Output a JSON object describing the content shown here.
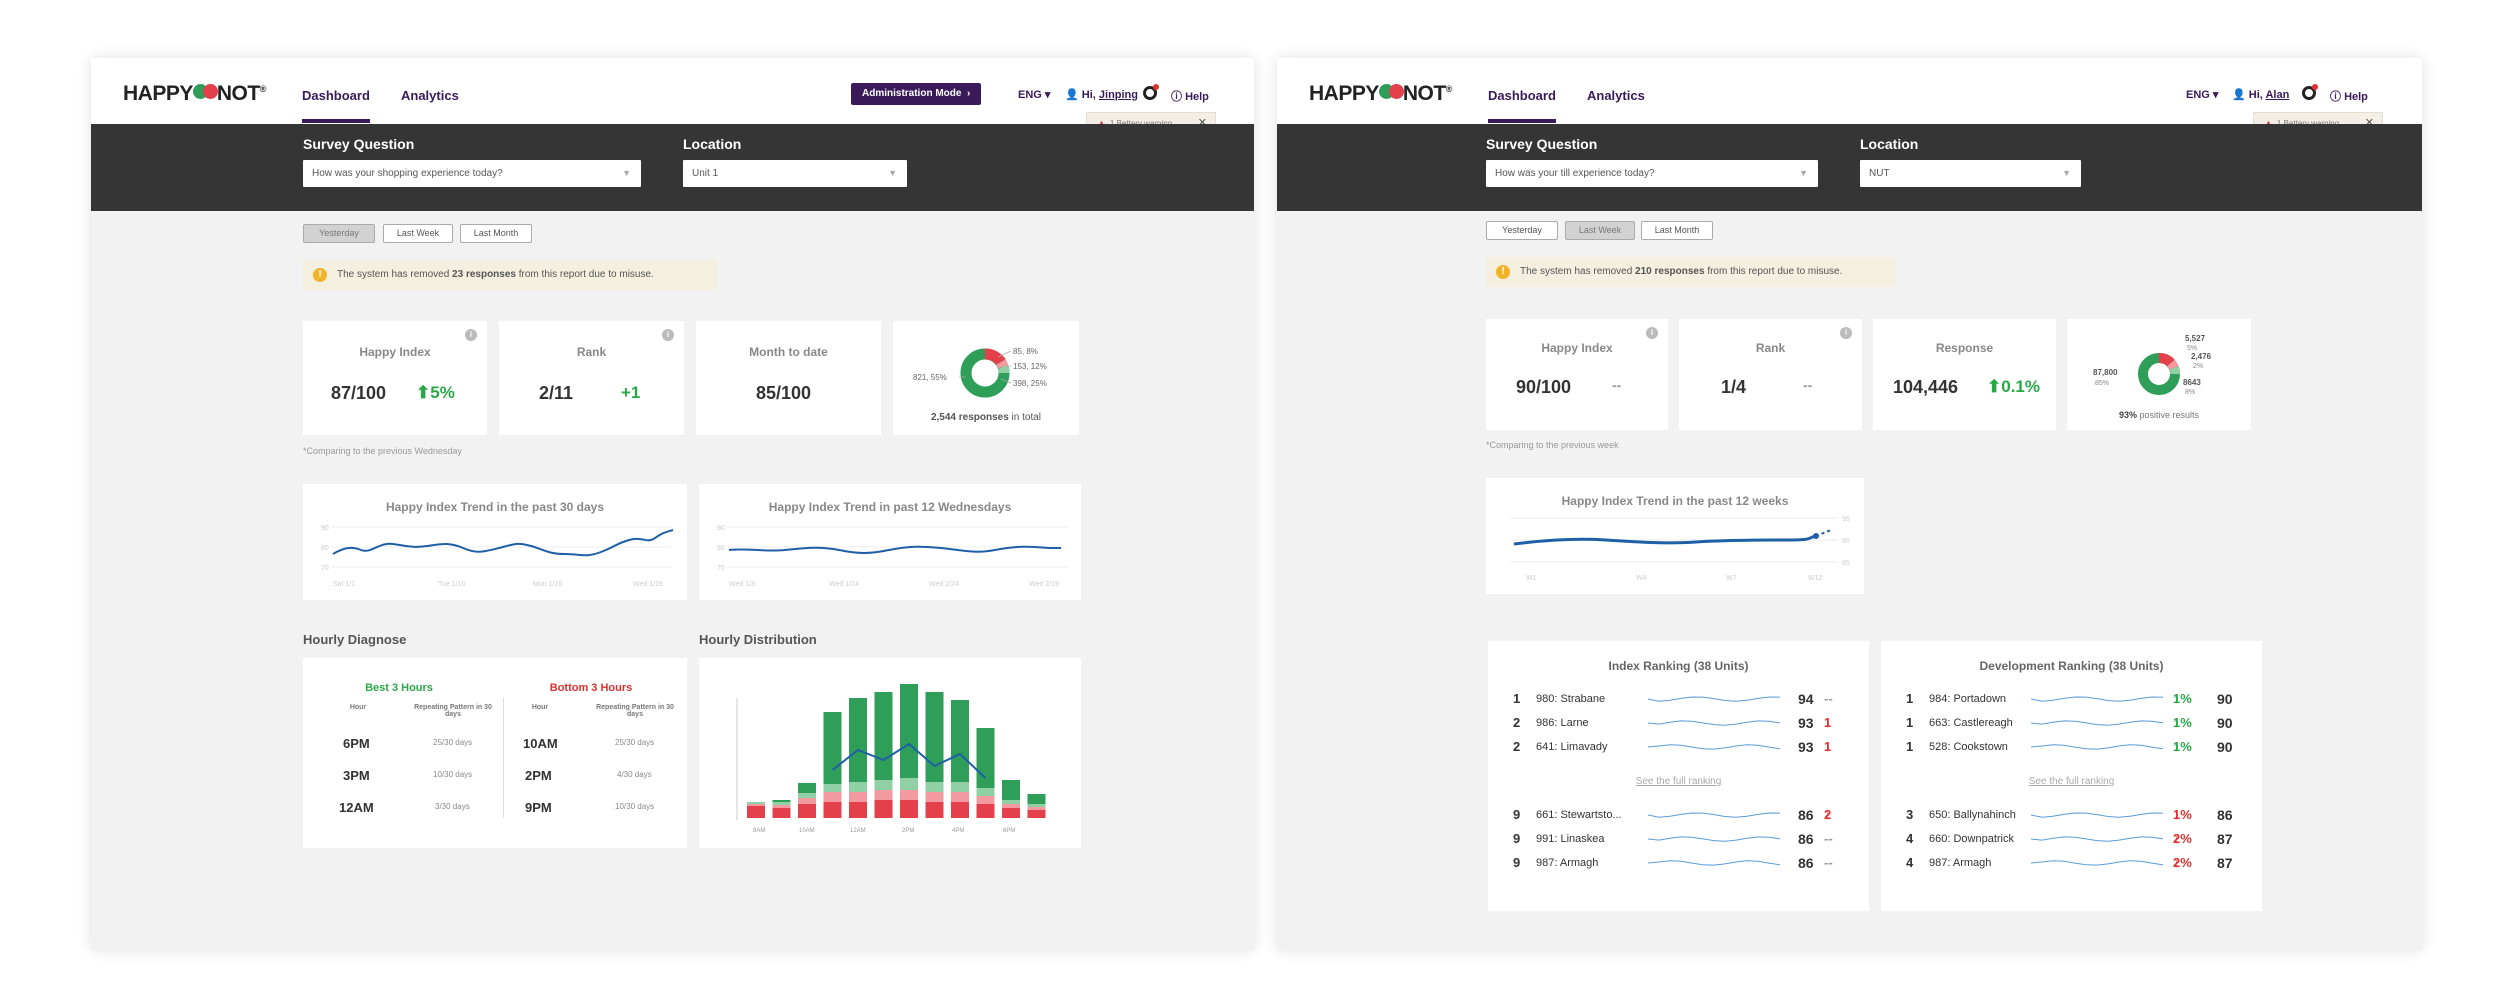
{
  "left": {
    "logo": "HAPPY NOT",
    "nav": {
      "dashboard": "Dashboard",
      "analytics": "Analytics"
    },
    "admin_button": "Administration Mode",
    "lang": "ENG",
    "greeting": "Hi,",
    "user": "Jinping",
    "help": "Help",
    "toast": "1 Bettery warning",
    "survey_label": "Survey Question",
    "survey_value": "How was your shopping experience today?",
    "location_label": "Location",
    "location_value": "Unit 1",
    "periods": [
      "Yesterday",
      "Last Week",
      "Last Month"
    ],
    "selected_period": "Yesterday",
    "notice_prefix": "The system has removed ",
    "notice_bold": "23 responses",
    "notice_suffix": " from this report due to misuse.",
    "kpi": {
      "happy_index": {
        "title": "Happy Index",
        "value": "87/100",
        "change": "5%"
      },
      "rank": {
        "title": "Rank",
        "value": "2/11",
        "change": "+1"
      },
      "mtd": {
        "title": "Month to date",
        "value": "85/100"
      },
      "donut": {
        "labels": [
          "85, 8%",
          "153, 12%",
          "398, 25%",
          "821, 55%"
        ],
        "total_bold": "2,544 responses",
        "total_suffix": " in total"
      }
    },
    "compare_note": "*Comparing to the previous Wednesday",
    "trend30": {
      "title": "Happy Index Trend in the past 30 days",
      "yticks": [
        "90",
        "80",
        "70"
      ],
      "xticks": [
        "Sat 1/1",
        "Tue 1/10",
        "Mon 1/16",
        "Wed 1/19"
      ]
    },
    "trend12": {
      "title": "Happy Index Trend in past 12 Wednesdays",
      "yticks": [
        "90",
        "80",
        "70"
      ],
      "xticks": [
        "Wed 1/3",
        "Wed 1/24",
        "Wed 2/24",
        "Wed 2/19"
      ]
    },
    "hourly_diagnose": {
      "title": "Hourly Diagnose",
      "best_title": "Best 3 Hours",
      "worst_title": "Bottom 3 Hours",
      "col_hour": "Hour",
      "col_pattern": "Repeating Pattern in 30 days",
      "best": [
        {
          "hour": "6PM",
          "pattern": "25/30 days"
        },
        {
          "hour": "3PM",
          "pattern": "10/30 days"
        },
        {
          "hour": "12AM",
          "pattern": "3/30 days"
        }
      ],
      "worst": [
        {
          "hour": "10AM",
          "pattern": "25/30 days"
        },
        {
          "hour": "2PM",
          "pattern": "4/30 days"
        },
        {
          "hour": "9PM",
          "pattern": "10/30 days"
        }
      ]
    },
    "hourly_distribution": {
      "title": "Hourly Distribution",
      "xticks": [
        "8AM",
        "10AM",
        "12AM",
        "2PM",
        "4PM",
        "6PM"
      ]
    }
  },
  "right": {
    "logo": "HAPPY NOT",
    "nav": {
      "dashboard": "Dashboard",
      "analytics": "Analytics"
    },
    "lang": "ENG",
    "greeting": "Hi,",
    "user": "Alan",
    "help": "Help",
    "toast": "1 Bettery warning",
    "survey_label": "Survey Question",
    "survey_value": "How was your till experience today?",
    "location_label": "Location",
    "location_value": "NUT",
    "periods": [
      "Yesterday",
      "Last Week",
      "Last Month"
    ],
    "selected_period": "Last Week",
    "notice_prefix": "The system has removed ",
    "notice_bold": "210 responses",
    "notice_suffix": " from this report due to misuse.",
    "kpi": {
      "happy_index": {
        "title": "Happy Index",
        "value": "90/100",
        "change": "--"
      },
      "rank": {
        "title": "Rank",
        "value": "1/4",
        "change": "--"
      },
      "response": {
        "title": "Response",
        "value": "104,446",
        "change": "0.1%"
      },
      "donut": {
        "left": "87,800",
        "left_pct": "85%",
        "labels": [
          "5,527",
          "5%",
          "2,476",
          "2%",
          "8643",
          "8%"
        ],
        "pos_bold": "93%",
        "pos_suffix": " positive results"
      }
    },
    "compare_note": "*Comparing to the previous week",
    "trend12w": {
      "title": "Happy Index Trend in the past 12 weeks",
      "yticks": [
        "95",
        "90",
        "85"
      ],
      "xticks": [
        "W1",
        "W4",
        "W7",
        "W12"
      ]
    },
    "index_ranking": {
      "title": "Index Ranking (38 Units)",
      "top": [
        {
          "rank": "1",
          "name": "980: Strabane",
          "score": "94",
          "change": "--",
          "dir": "none"
        },
        {
          "rank": "2",
          "name": "986: Larne",
          "score": "93",
          "change": "1",
          "dir": "down"
        },
        {
          "rank": "2",
          "name": "641: Limavady",
          "score": "93",
          "change": "1",
          "dir": "down"
        }
      ],
      "see_all": "See the full ranking",
      "bottom": [
        {
          "rank": "9",
          "name": "661: Stewartsto...",
          "score": "86",
          "change": "2",
          "dir": "down"
        },
        {
          "rank": "9",
          "name": "991: Linaskea",
          "score": "86",
          "change": "--",
          "dir": "none"
        },
        {
          "rank": "9",
          "name": "987: Armagh",
          "score": "86",
          "change": "--",
          "dir": "none"
        }
      ]
    },
    "dev_ranking": {
      "title": "Development Ranking (38 Units)",
      "top": [
        {
          "rank": "1",
          "name": "984: Portadown",
          "change": "1%",
          "dir": "up",
          "score": "90"
        },
        {
          "rank": "1",
          "name": "663: Castlereagh",
          "change": "1%",
          "dir": "up",
          "score": "90"
        },
        {
          "rank": "1",
          "name": "528: Cookstown",
          "change": "1%",
          "dir": "up",
          "score": "90"
        }
      ],
      "see_all": "See the full ranking",
      "bottom": [
        {
          "rank": "3",
          "name": "650: Ballynahinch",
          "change": "1%",
          "dir": "down",
          "score": "86"
        },
        {
          "rank": "4",
          "name": "660: Downpatrick",
          "change": "2%",
          "dir": "down",
          "score": "87"
        },
        {
          "rank": "4",
          "name": "987: Armagh",
          "change": "2%",
          "dir": "down",
          "score": "87"
        }
      ]
    }
  },
  "colors": {
    "brand": "#3a1a5a",
    "positive": "#2e9e58",
    "negative": "#e3404b",
    "line": "#1f5fa8"
  }
}
